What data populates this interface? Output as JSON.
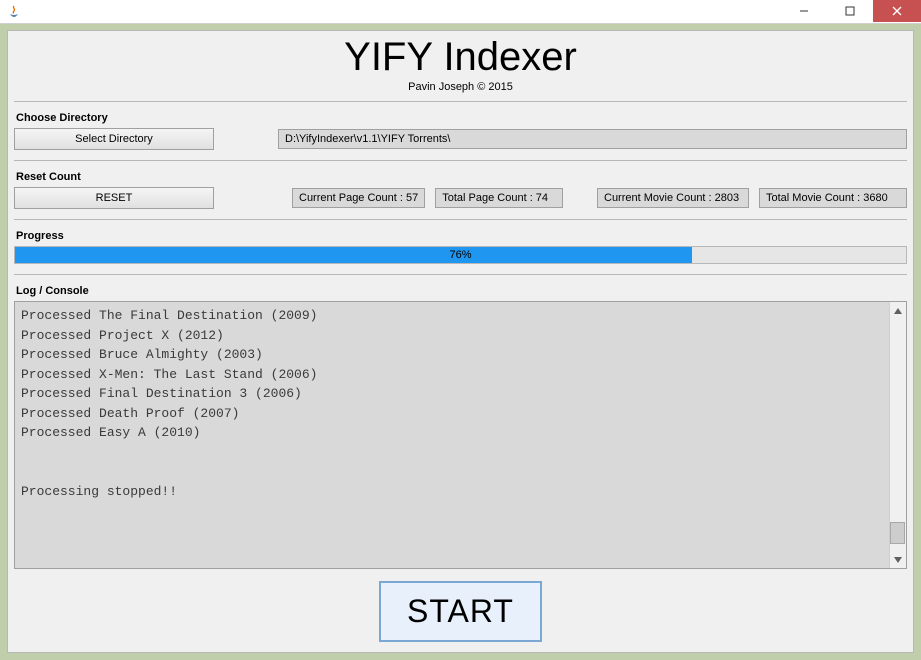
{
  "titlebar": {
    "title": ""
  },
  "header": {
    "app_title": "YIFY Indexer",
    "author": "Pavin Joseph © 2015"
  },
  "directory": {
    "section_label": "Choose Directory",
    "select_button": "Select Directory",
    "path": "D:\\YifyIndexer\\v1.1\\YIFY Torrents\\"
  },
  "reset": {
    "section_label": "Reset Count",
    "reset_button": "RESET",
    "current_page": "Current Page Count : 57",
    "total_page": "Total Page Count : 74",
    "current_movie": "Current Movie Count : 2803",
    "total_movie": "Total Movie Count : 3680"
  },
  "progress": {
    "section_label": "Progress",
    "percent": 76,
    "label": "76%"
  },
  "console": {
    "section_label": "Log / Console",
    "text": "Processed The Final Destination (2009)\nProcessed Project X (2012)\nProcessed Bruce Almighty (2003)\nProcessed X-Men: The Last Stand (2006)\nProcessed Final Destination 3 (2006)\nProcessed Death Proof (2007)\nProcessed Easy A (2010)\n\n\nProcessing stopped!!"
  },
  "start": {
    "label": "START"
  }
}
